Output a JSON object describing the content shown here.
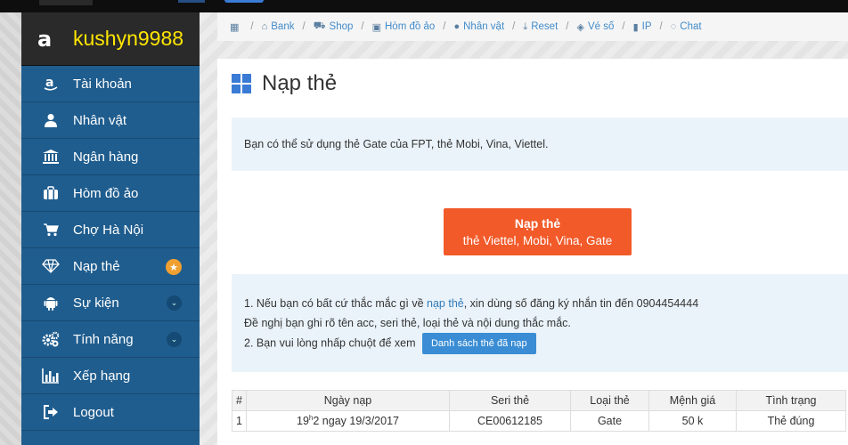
{
  "sidebar": {
    "username": "kushyn9988",
    "items": [
      {
        "label": "Tài khoản",
        "icon": "amazon-icon"
      },
      {
        "label": "Nhân vật",
        "icon": "user-icon"
      },
      {
        "label": "Ngân hàng",
        "icon": "bank-icon"
      },
      {
        "label": "Hòm đồ ảo",
        "icon": "briefcase-icon"
      },
      {
        "label": "Chợ Hà Nội",
        "icon": "cart-icon"
      },
      {
        "label": "Nạp thẻ",
        "icon": "diamond-icon",
        "badge": "★"
      },
      {
        "label": "Sự kiện",
        "icon": "android-icon",
        "chevron": "⌄"
      },
      {
        "label": "Tính năng",
        "icon": "gears-icon",
        "chevron": "⌄"
      },
      {
        "label": "Xếp hạng",
        "icon": "bar-chart-icon"
      },
      {
        "label": "Logout",
        "icon": "logout-icon"
      }
    ]
  },
  "breadcrumb": [
    {
      "label": "",
      "icon": "calendar-icon"
    },
    {
      "label": "Bank",
      "icon": "bank-icon"
    },
    {
      "label": "Shop",
      "icon": "cart-icon"
    },
    {
      "label": "Hòm đồ ảo",
      "icon": "briefcase-icon"
    },
    {
      "label": "Nhân vật",
      "icon": "user-icon"
    },
    {
      "label": "Reset",
      "icon": "reset-icon"
    },
    {
      "label": "Vé số",
      "icon": "ticket-icon"
    },
    {
      "label": "IP",
      "icon": "lock-icon"
    },
    {
      "label": "Chat",
      "icon": "chat-icon"
    }
  ],
  "main": {
    "title": "Nạp thẻ",
    "info": "Bạn có thể sử dụng thẻ Gate của FPT, thẻ Mobi, Vina, Viettel.",
    "cta_line1": "Nạp thẻ",
    "cta_line2": "thẻ Viettel, Mobi, Vina, Gate",
    "help_line1_prefix": "1. Nếu bạn có bất cứ thắc mắc gì về ",
    "help_line1_link": "nạp thẻ",
    "help_line1_suffix": ", xin dùng số đăng ký nhắn tin đến 0904454444",
    "help_line2": "Đề nghị bạn ghi rõ tên acc, seri thẻ, loại thẻ và nội dung thắc mắc.",
    "help_line3": "2. Bạn vui lòng nhấp chuột để xem",
    "history_button": "Danh sách thẻ đã nạp"
  },
  "table": {
    "headers": [
      "#",
      "Ngày nạp",
      "Seri thẻ",
      "Loại thẻ",
      "Mệnh giá",
      "Tình trạng"
    ],
    "rows": [
      {
        "num": "1",
        "date_hour": "19",
        "date_sup": "h",
        "date_rest": "2 ngay 19/3/2017",
        "serial": "CE00612185",
        "type": "Gate",
        "value": "50 k",
        "status": "Thẻ đúng"
      }
    ]
  },
  "colors": {
    "sidebar": "#1f5d8e",
    "cta": "#f25a29",
    "username": "#ffe600",
    "info_bg": "#eaf3fa"
  }
}
